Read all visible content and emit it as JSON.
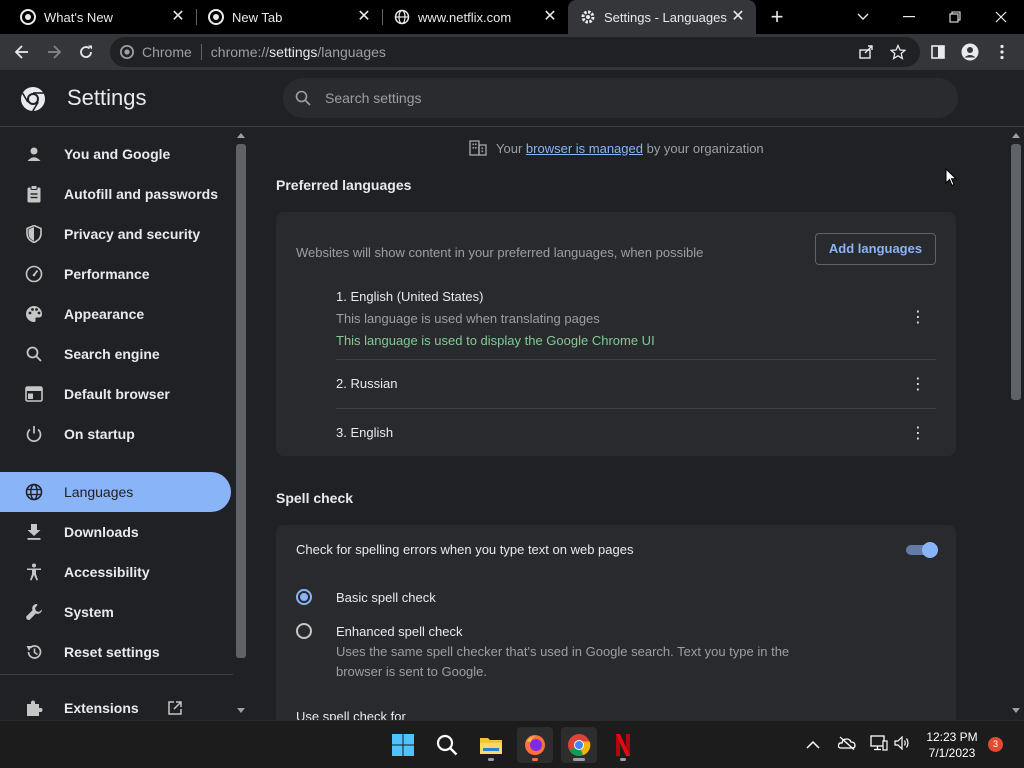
{
  "tabs": [
    {
      "title": "What's New",
      "icon": "chrome-icon"
    },
    {
      "title": "New Tab",
      "icon": "chrome-icon"
    },
    {
      "title": "www.netflix.com",
      "icon": "globe-icon"
    },
    {
      "title": "Settings - Languages",
      "icon": "gear-icon",
      "active": true
    }
  ],
  "omnibox": {
    "site_label": "Chrome",
    "url_prefix": "chrome://",
    "url_host": "settings",
    "url_path": "/languages"
  },
  "settings": {
    "title": "Settings",
    "search_placeholder": "Search settings"
  },
  "sidebar": {
    "items": [
      {
        "label": "You and Google",
        "icon": "person-icon"
      },
      {
        "label": "Autofill and passwords",
        "icon": "clipboard-icon"
      },
      {
        "label": "Privacy and security",
        "icon": "shield-icon"
      },
      {
        "label": "Performance",
        "icon": "speedometer-icon"
      },
      {
        "label": "Appearance",
        "icon": "palette-icon"
      },
      {
        "label": "Search engine",
        "icon": "search-icon"
      },
      {
        "label": "Default browser",
        "icon": "browser-icon"
      },
      {
        "label": "On startup",
        "icon": "power-icon"
      },
      {
        "label": "Languages",
        "icon": "globe-icon",
        "selected": true
      },
      {
        "label": "Downloads",
        "icon": "download-icon"
      },
      {
        "label": "Accessibility",
        "icon": "accessibility-icon"
      },
      {
        "label": "System",
        "icon": "wrench-icon"
      },
      {
        "label": "Reset settings",
        "icon": "history-icon"
      },
      {
        "label": "Extensions",
        "icon": "puzzle-icon"
      }
    ]
  },
  "managed": {
    "prefix": "Your",
    "link": "browser is managed",
    "suffix": "by your organization"
  },
  "preferred": {
    "title": "Preferred languages",
    "description": "Websites will show content in your preferred languages, when possible",
    "add_button": "Add languages",
    "languages": [
      {
        "name": "1. English (United States)",
        "note1": "This language is used when translating pages",
        "note2": "This language is used to display the Google Chrome UI"
      },
      {
        "name": "2. Russian"
      },
      {
        "name": "3. English"
      }
    ]
  },
  "spellcheck": {
    "title": "Spell check",
    "toggle_label": "Check for spelling errors when you type text on web pages",
    "toggle_on": true,
    "basic_label": "Basic spell check",
    "enhanced_label": "Enhanced spell check",
    "enhanced_desc_line1": "Uses the same spell checker that's used in Google search. Text you type in the",
    "enhanced_desc_line2": "browser is sent to Google.",
    "use_for": "Use spell check for",
    "selected": "basic"
  },
  "taskbar": {
    "time": "12:23 PM",
    "date": "7/1/2023",
    "notification_count": "3"
  },
  "colors": {
    "accent": "#8ab4f8",
    "green_note": "#81c995",
    "background": "#202124",
    "card": "#292a2d"
  }
}
